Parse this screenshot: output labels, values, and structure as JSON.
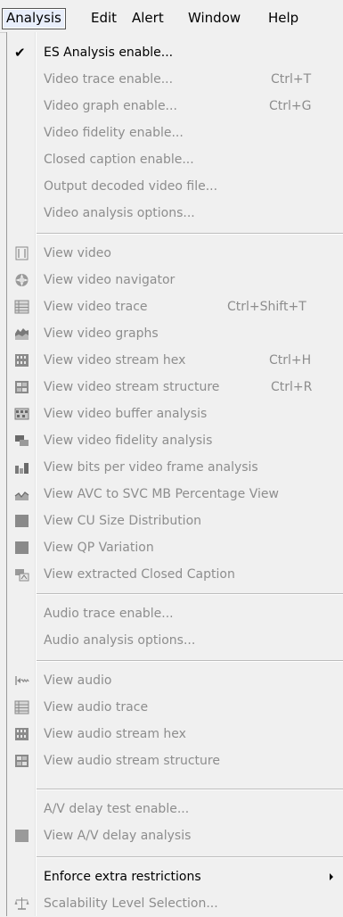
{
  "menubar": {
    "analysis": "Analysis",
    "edit": "Edit",
    "alert": "Alert",
    "window": "Window",
    "help": "Help"
  },
  "menu": {
    "es_analysis": {
      "label": "ES Analysis enable...",
      "checked": true
    },
    "video_trace_enable": {
      "label": "Video trace enable...",
      "shortcut": "Ctrl+T"
    },
    "video_graph_enable": {
      "label": "Video graph enable...",
      "shortcut": "Ctrl+G"
    },
    "video_fidelity_enable": {
      "label": "Video fidelity enable..."
    },
    "closed_caption_enable": {
      "label": "Closed caption enable..."
    },
    "output_decoded": {
      "label": "Output decoded video file..."
    },
    "video_analysis_options": {
      "label": "Video analysis options..."
    },
    "view_video": {
      "label": "View video",
      "icon": "video-frame-icon"
    },
    "view_video_navigator": {
      "label": "View video navigator",
      "icon": "navigator-icon"
    },
    "view_video_trace": {
      "label": "View video trace",
      "shortcut": "Ctrl+Shift+T",
      "icon": "trace-table-icon"
    },
    "view_video_graphs": {
      "label": "View video graphs",
      "icon": "area-graph-icon"
    },
    "view_video_stream_hex": {
      "label": "View video stream hex",
      "shortcut": "Ctrl+H",
      "icon": "hex-icon"
    },
    "view_video_stream_structure": {
      "label": "View video stream structure",
      "shortcut": "Ctrl+R",
      "icon": "structure-icon"
    },
    "view_video_buffer": {
      "label": "View video buffer analysis",
      "icon": "buffer-icon"
    },
    "view_video_fidelity": {
      "label": "View video fidelity analysis",
      "icon": "fidelity-icon"
    },
    "view_bits_per_frame": {
      "label": "View bits per video frame analysis",
      "icon": "bar-chart-icon"
    },
    "view_avc_svc": {
      "label": "View AVC to SVC MB Percentage View",
      "icon": "line-graph-icon"
    },
    "view_cu_size": {
      "label": "View CU Size Distribution",
      "icon": "gray-square-icon"
    },
    "view_qp_variation": {
      "label": "View QP Variation",
      "icon": "gray-square-icon"
    },
    "view_closed_caption": {
      "label": "View extracted Closed Caption",
      "icon": "caption-icon"
    },
    "audio_trace_enable": {
      "label": "Audio trace enable..."
    },
    "audio_analysis_options": {
      "label": "Audio analysis options..."
    },
    "view_audio": {
      "label": "View audio",
      "icon": "audio-icon"
    },
    "view_audio_trace": {
      "label": "View audio trace",
      "icon": "trace-table-icon"
    },
    "view_audio_stream_hex": {
      "label": "View audio stream hex",
      "icon": "hex-icon"
    },
    "view_audio_stream_structure": {
      "label": "View audio stream structure",
      "icon": "structure-icon"
    },
    "av_delay_test": {
      "label": "A/V delay test enable..."
    },
    "view_av_delay": {
      "label": "View A/V delay analysis",
      "icon": "gray-square-icon"
    },
    "enforce_restrictions": {
      "label": "Enforce extra restrictions",
      "submenu": true
    },
    "scalability": {
      "label": "Scalability Level Selection...",
      "icon": "scale-icon"
    }
  },
  "colors": {
    "menu_bg": "#f0f0f0",
    "disabled_text": "#8d8d8d",
    "separator": "#bcbcbc",
    "icon_gray": "#8a8a8a"
  }
}
